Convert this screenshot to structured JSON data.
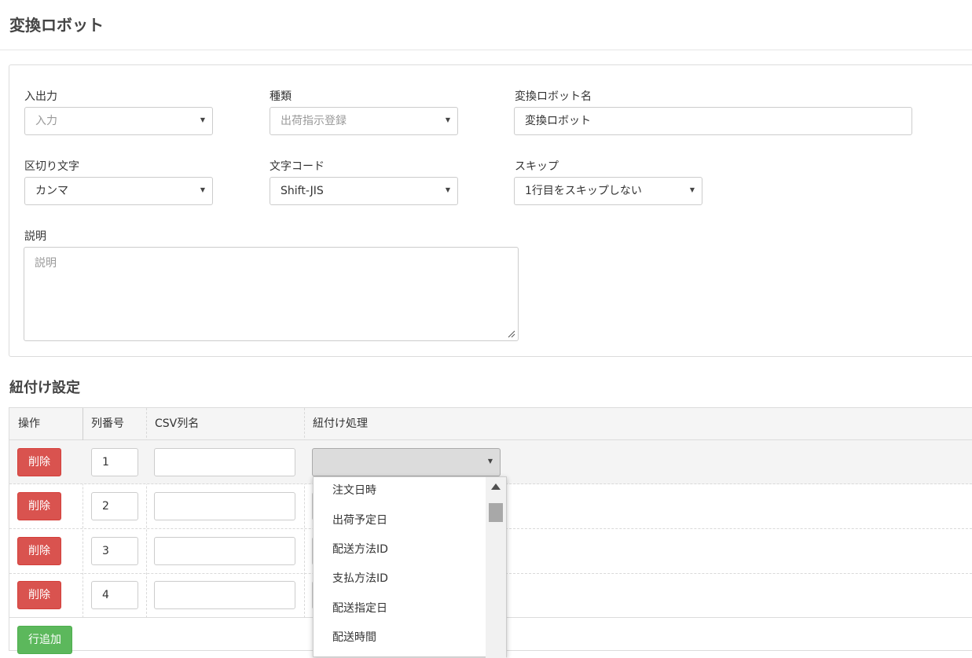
{
  "page": {
    "title": "変換ロボット"
  },
  "form": {
    "io": {
      "label": "入出力",
      "value": "入力"
    },
    "kind": {
      "label": "種類",
      "value": "出荷指示登録"
    },
    "robot_name": {
      "label": "変換ロボット名",
      "value": "変換ロボット"
    },
    "delimiter": {
      "label": "区切り文字",
      "value": "カンマ"
    },
    "charset": {
      "label": "文字コード",
      "value": "Shift-JIS"
    },
    "skip": {
      "label": "スキップ",
      "value": "1行目をスキップしない"
    },
    "description": {
      "label": "説明",
      "placeholder": "説明"
    }
  },
  "mapping": {
    "title": "紐付け設定",
    "headers": {
      "op": "操作",
      "col_no": "列番号",
      "csv_name": "CSV列名",
      "process": "紐付け処理"
    },
    "rows": [
      {
        "delete_label": "削除",
        "col_no": "1",
        "csv_name": ""
      },
      {
        "delete_label": "削除",
        "col_no": "2",
        "csv_name": ""
      },
      {
        "delete_label": "削除",
        "col_no": "3",
        "csv_name": ""
      },
      {
        "delete_label": "削除",
        "col_no": "4",
        "csv_name": ""
      }
    ],
    "add_row_label": "行追加"
  },
  "dropdown": {
    "options": [
      "注文日時",
      "出荷予定日",
      "配送方法ID",
      "支払方法ID",
      "配送指定日",
      "配送時間"
    ]
  },
  "colors": {
    "danger": "#d9534f",
    "success": "#5cb85c"
  }
}
